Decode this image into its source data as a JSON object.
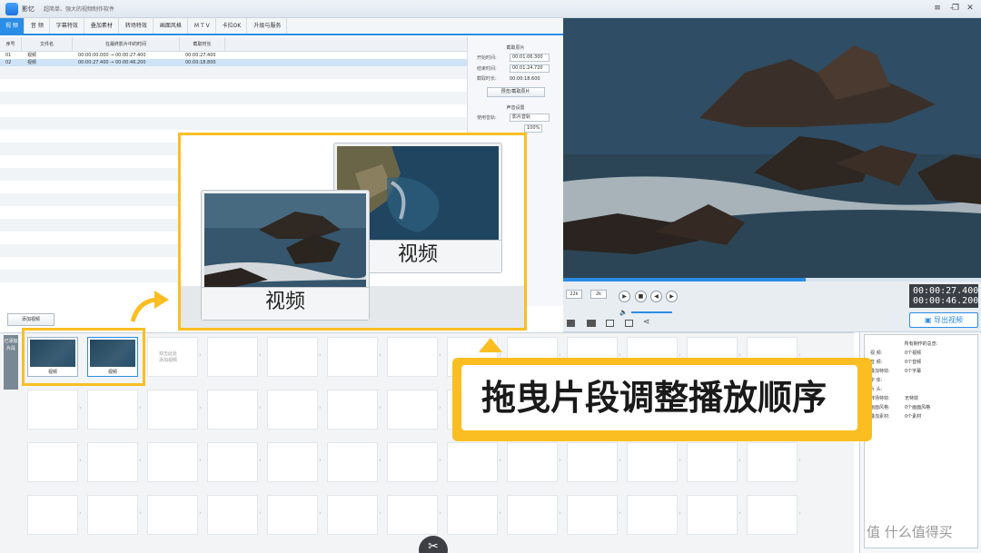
{
  "app": {
    "name": "影忆",
    "slogan": "超简单、强大的视频制作软件"
  },
  "tabs": [
    "视 频",
    "音 频",
    "字幕特效",
    "叠加素材",
    "转场特效",
    "画面风格",
    "M T V",
    "卡拉OK",
    "升级与服务"
  ],
  "cliplist": {
    "headers": [
      "序号",
      "文件名",
      "在最终影片中的时间",
      "截取时长"
    ],
    "rows": [
      {
        "index": "01",
        "name": "视频",
        "span": "00:00:00.000 → 00:00:27.400",
        "dur": "00:00:27.400",
        "selected": false
      },
      {
        "index": "02",
        "name": "视频",
        "span": "00:00:27.400 → 00:00:46.200",
        "dur": "00:00:18.800",
        "selected": true
      }
    ]
  },
  "settings": {
    "section1": "截取原片",
    "start_label": "开始时间:",
    "start_value": "00:01:06.300",
    "end_label": "结束时间:",
    "end_value": "00:01:24.720",
    "dur_label": "截取时长:",
    "dur_value": "00:00:18.600",
    "preview_btn": "预览/截取原片",
    "section2": "声音设置",
    "use_label": "使用音轨:",
    "use_value": "影片音轨",
    "volume_value": "100%"
  },
  "preview": {
    "progress": 0.58,
    "speed_value": "22k",
    "speed_value2": "2k",
    "time_current": "00:00:27.400",
    "time_total": "00:00:46.200",
    "export_label": "导出视频"
  },
  "timeline": {
    "add_video_label": "添加视频",
    "side_label": "已添加片段",
    "clips": [
      "视频",
      "视频"
    ],
    "empty_hint_1": "双击此处",
    "empty_hint_2": "添加视频"
  },
  "info": {
    "title": "所有制作的总览:",
    "rows": [
      {
        "k": "视  频:",
        "v": "0个视频"
      },
      {
        "k": "音  频:",
        "v": "0个音频"
      },
      {
        "k": "叠加特效:",
        "v": "0个字幕"
      },
      {
        "k": "字 体:",
        "v": ""
      },
      {
        "k": "片 头:",
        "v": ""
      },
      {
        "k": "转场特效:",
        "v": "无特效"
      },
      {
        "k": "画面风格:",
        "v": "0个画面风格"
      },
      {
        "k": "叠加素材:",
        "v": "0个素材"
      }
    ]
  },
  "overlay": {
    "card_back_caption": "视频",
    "card_front_caption": "视频",
    "callout_text": "拖曳片段调整播放顺序"
  },
  "watermark": "值 什么值得买",
  "colors": {
    "accent": "#2a8de6",
    "highlight": "#fbbe22"
  }
}
